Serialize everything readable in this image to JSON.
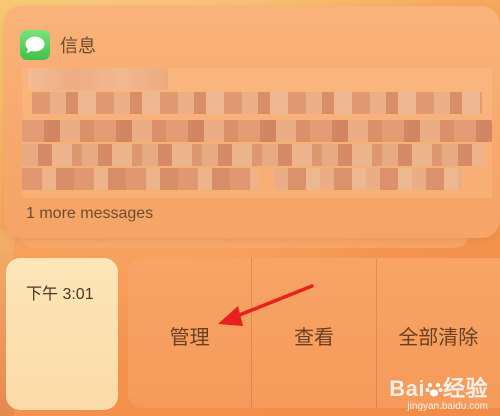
{
  "notification": {
    "app_name": "信息",
    "more_messages": "1 more messages"
  },
  "time_tile": {
    "time": "下午 3:01"
  },
  "actions": {
    "manage": "管理",
    "view": "查看",
    "clear_all": "全部清除"
  },
  "watermark": {
    "brand": "Bai",
    "brand_suffix": "经验",
    "url": "jingyan.baidu.com"
  },
  "icons": {
    "app": "messages-icon",
    "annotation": "arrow-icon"
  },
  "colors": {
    "arrow": "#e8211e",
    "messages_green": "#3fc14a"
  }
}
